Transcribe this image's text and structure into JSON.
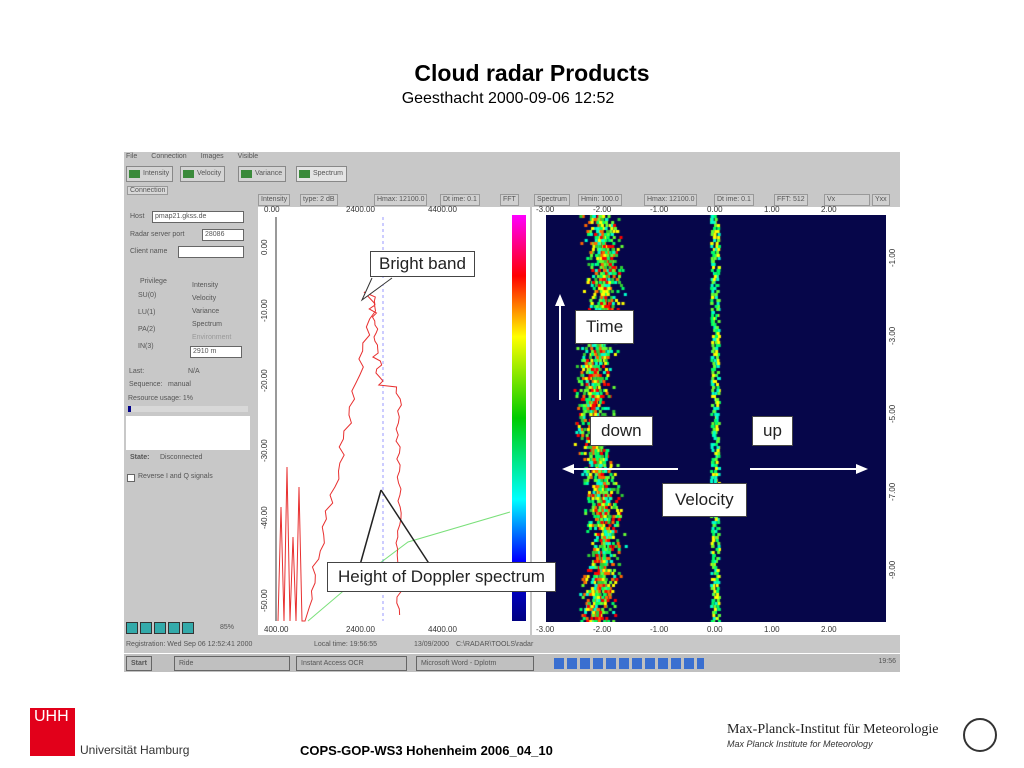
{
  "slide": {
    "title": "Cloud radar Products",
    "subtitle": "Geesthacht 2000-09-06 12:52",
    "footer": "COPS-GOP-WS3 Hohenheim 2006_04_10"
  },
  "logos": {
    "left_mark": "UHH",
    "left_name": "Universität Hamburg",
    "right_name": "Max-Planck-Institut für Meteorologie",
    "right_name_en": "Max Planck Institute for Meteorology"
  },
  "app": {
    "menu": [
      "File",
      "Connection",
      "Images",
      "Visible"
    ],
    "tabs": [
      "Intensity",
      "Velocity",
      "Variance",
      "Spectrum"
    ],
    "panel": {
      "tab": "Connection",
      "host_label": "Host",
      "host_value": "pmap21.gkss.de",
      "port_label": "Radar server port",
      "port_value": "28086",
      "client_label": "Client name",
      "client_value": "",
      "privilege_label": "Privilege",
      "radios": [
        "SU(0)",
        "LU(1)",
        "PA(2)",
        "IN(3)"
      ],
      "checks": [
        {
          "label": "Intensity",
          "checked": true
        },
        {
          "label": "Velocity",
          "checked": true
        },
        {
          "label": "Variance",
          "checked": true
        },
        {
          "label": "Spectrum",
          "checked": true
        },
        {
          "label": "Environment",
          "checked": false
        }
      ],
      "range_value": "2910 m",
      "last_label": "Last:",
      "last_value": "N/A",
      "sequence_label": "Sequence:",
      "sequence_value": "manual",
      "resource_label": "Resource usage: 1%",
      "resource_pct": 1,
      "state_label": "State:",
      "state_value": "Disconnected",
      "reverse_label": "Reverse I and Q signals",
      "zoom_value": "85%"
    },
    "left_plot": {
      "headers": [
        "Intensity",
        "type: 2 dB",
        "Hmax: 12100.0",
        "Dt ime: 0.1",
        "FFT"
      ],
      "x_top": [
        "0.00",
        "2400.00",
        "4400.00"
      ],
      "x_bottom": [
        "400.00",
        "2400.00",
        "4400.00"
      ],
      "y": [
        "0.00",
        "-10.00",
        "-20.00",
        "-30.00",
        "-40.00",
        "-50.00"
      ]
    },
    "right_plot": {
      "headers": [
        "Spectrum",
        "Hmin: 100.0",
        "Hmax: 12100.0",
        "Dt ime: 0.1",
        "FFT: 512",
        "Vx",
        "Yxx"
      ],
      "x": [
        "-3.00",
        "-2.00",
        "-1.00",
        "0.00",
        "1.00",
        "2.00"
      ],
      "y": [
        "-1.00",
        "-3.00",
        "-5.00",
        "-7.00",
        "-9.00"
      ]
    },
    "status": [
      "Registration: Wed Sep 06 12:52:41 2000",
      "Local time: 19:56:55",
      "13/09/2000",
      "C:\\RADAR\\TOOLS\\radar"
    ],
    "taskbar": {
      "start": "Start",
      "items": [
        "Ride",
        "Instant Access OCR",
        "Microsoft Word - Dplotm"
      ],
      "clock": "19:56"
    }
  },
  "annotations": {
    "bright_band": "Bright band",
    "time": "Time",
    "down": "down",
    "up": "up",
    "velocity": "Velocity",
    "height": "Height of Doppler spectrum"
  },
  "colors": {
    "plot_bg": "#06064a",
    "line": "#e83030",
    "uhh_red": "#e2001a"
  }
}
